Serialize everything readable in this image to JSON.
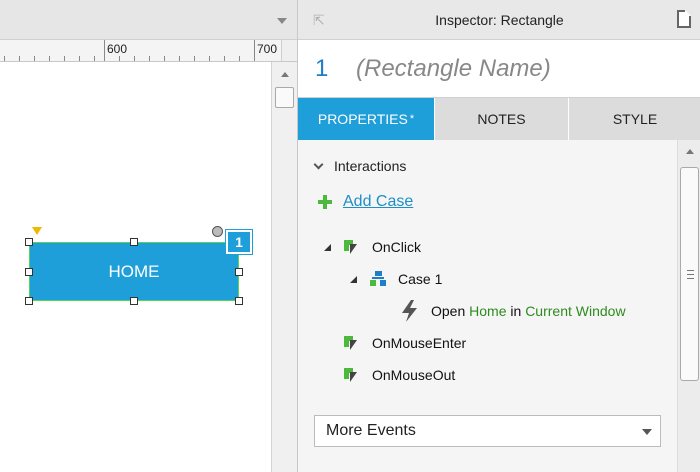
{
  "ruler": {
    "label_600": "600",
    "label_700": "700"
  },
  "widget": {
    "label": "HOME",
    "footnote_number": "1"
  },
  "inspector": {
    "title": "Inspector: Rectangle",
    "widget_number": "1",
    "widget_name_placeholder": "(Rectangle Name)",
    "tabs": [
      {
        "label": "PROPERTIES",
        "marker": "*"
      },
      {
        "label": "NOTES"
      },
      {
        "label": "STYLE"
      }
    ],
    "interactions": {
      "header": "Interactions",
      "add_case": "Add Case",
      "events": [
        {
          "name": "OnClick",
          "cases": [
            {
              "name": "Case 1",
              "action": {
                "verb": "Open",
                "target": "Home",
                "preposition": "in",
                "location": "Current Window"
              }
            }
          ]
        },
        {
          "name": "OnMouseEnter"
        },
        {
          "name": "OnMouseOut"
        }
      ],
      "more_events": "More Events"
    }
  },
  "colors": {
    "accent": "#1e9fd9",
    "link": "#1e8fc6",
    "green": "#2e8b1e",
    "selection_outline": "#56d456",
    "anchor": "#f0b800"
  }
}
